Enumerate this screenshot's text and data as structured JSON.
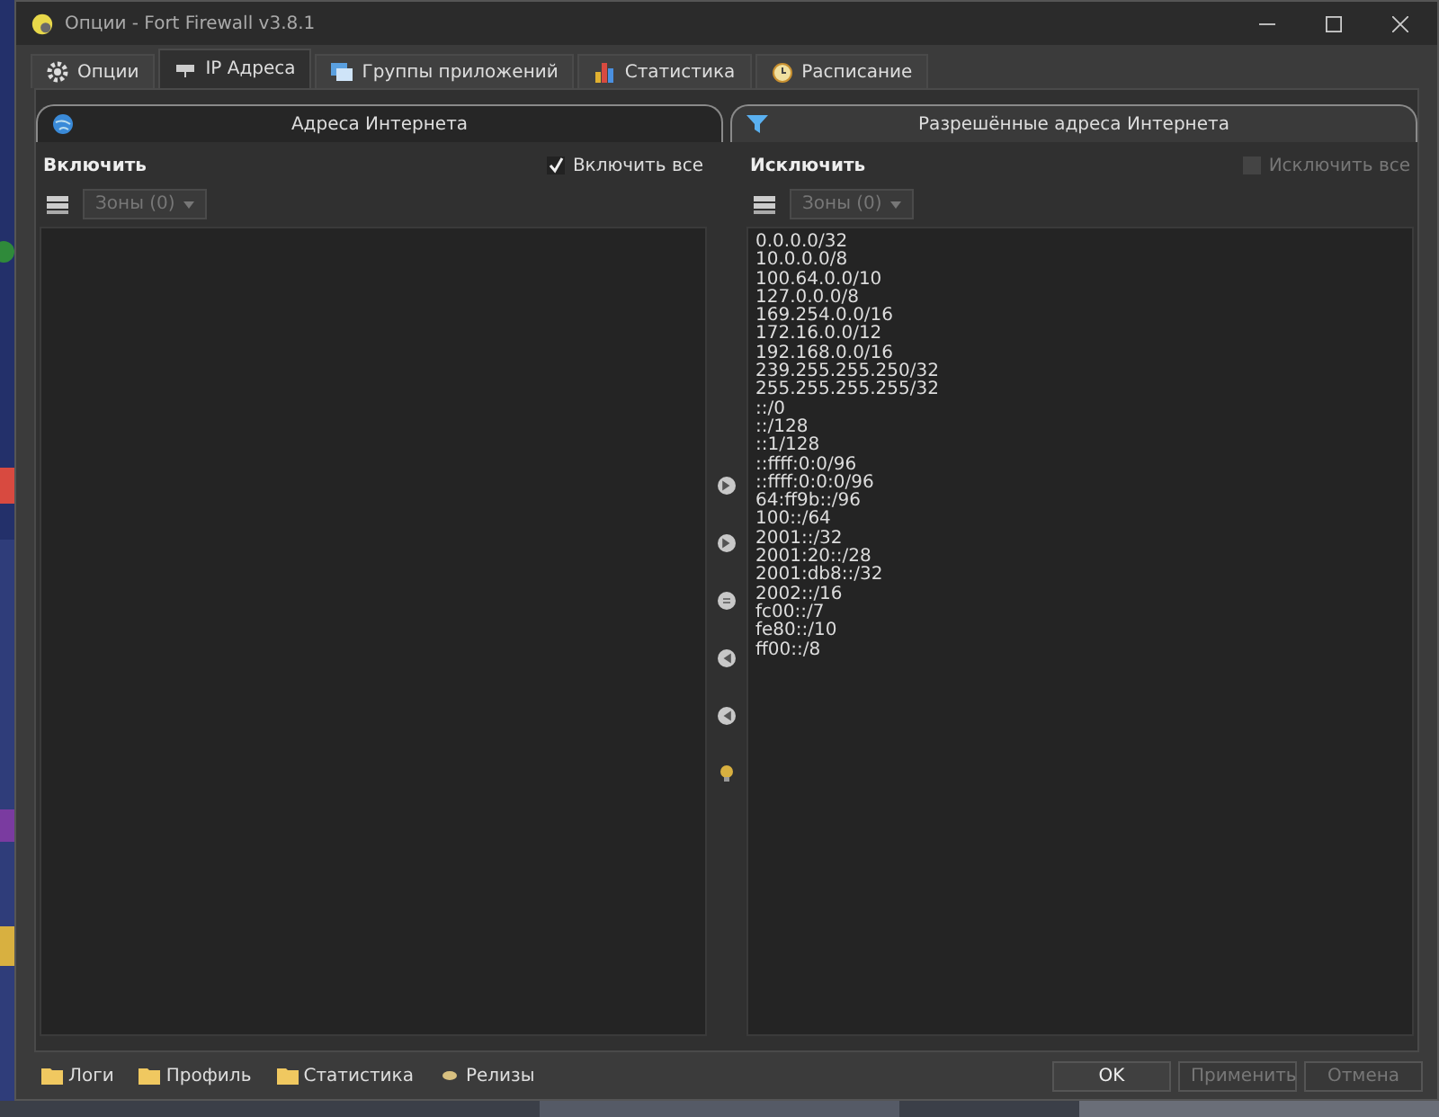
{
  "window": {
    "title": "Опции - Fort Firewall v3.8.1"
  },
  "tabs": [
    {
      "label": "Опции",
      "selected": false
    },
    {
      "label": "IP Адреса",
      "selected": true
    },
    {
      "label": "Группы приложений",
      "selected": false
    },
    {
      "label": "Статистика",
      "selected": false
    },
    {
      "label": "Расписание",
      "selected": false
    }
  ],
  "subtabs": [
    {
      "label": "Адреса Интернета",
      "selected": true
    },
    {
      "label": "Разрешённые адреса Интернета",
      "selected": false
    }
  ],
  "panels": [
    {
      "title": "Включить",
      "all_label": "Включить все",
      "all_checked": true,
      "all_disabled": false,
      "zones": "Зоны (0)"
    },
    {
      "title": "Исключить",
      "all_label": "Исключить все",
      "all_checked": false,
      "all_disabled": true,
      "zones": "Зоны (0)",
      "lines": [
        "0.0.0.0/32",
        "10.0.0.0/8",
        "100.64.0.0/10",
        "127.0.0.0/8",
        "169.254.0.0/16",
        "172.16.0.0/12",
        "192.168.0.0/16",
        "239.255.255.250/32",
        "255.255.255.255/32",
        "::/0",
        "::/128",
        "::1/128",
        "::ffff:0:0/96",
        "::ffff:0:0:0/96",
        "64:ff9b::/96",
        "100::/64",
        "2001::/32",
        "2001:20::/28",
        "2001:db8::/32",
        "2002::/16",
        "fc00::/7",
        "fe80::/10",
        "ff00::/8"
      ]
    }
  ],
  "footer_links": [
    {
      "label": "Логи",
      "kind": "folder"
    },
    {
      "label": "Профиль",
      "kind": "folder"
    },
    {
      "label": "Статистика",
      "kind": "folder"
    },
    {
      "label": "Релизы",
      "kind": "dot"
    }
  ],
  "buttons": [
    {
      "label": "OK",
      "disabled": false
    },
    {
      "label": "Применить",
      "disabled": true
    },
    {
      "label": "Отмена",
      "disabled": true
    }
  ]
}
